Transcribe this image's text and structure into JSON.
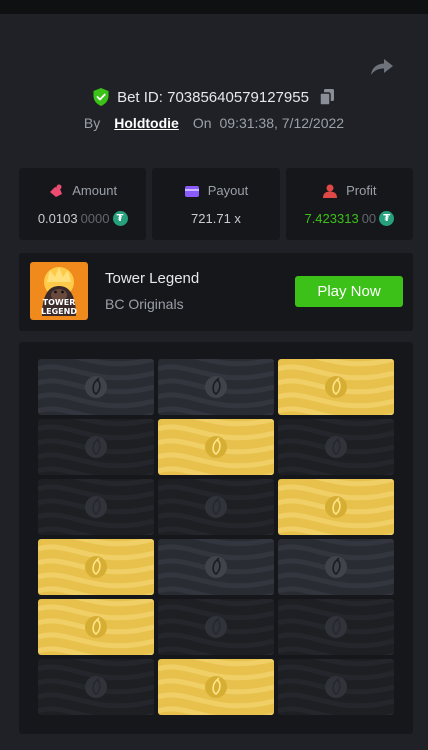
{
  "bet": {
    "id_label": "Bet ID: 70385640579127955",
    "by_label": "By",
    "user": "Holdtodie",
    "on_label": "On",
    "time": "09:31:38, 7/12/2022"
  },
  "stats": [
    {
      "label": "Amount",
      "value_main": "0.0103",
      "value_dim": "0000",
      "icon": "amount-icon",
      "color": "#ec4c72"
    },
    {
      "label": "Payout",
      "value_main": "721.71 x",
      "value_dim": "",
      "icon": "payout-icon",
      "color": "#8a5bff"
    },
    {
      "label": "Profit",
      "value_main": "7.423313",
      "value_dim": "00",
      "icon": "profit-icon",
      "color": "#e04848"
    }
  ],
  "currency": {
    "icon": "tether-icon",
    "glyph": "₮",
    "color": "#26a17b"
  },
  "game": {
    "title": "Tower Legend",
    "provider": "BC Originals",
    "play_label": "Play Now",
    "thumb_text_1": "TOWER",
    "thumb_text_2": "LEGEND"
  },
  "colors": {
    "accent_green": "#3bc117",
    "tile_gold": "#e7c14c",
    "tile_gray": "#2a2c33",
    "tile_dark": "#1d1f23"
  },
  "tower": {
    "rows": [
      [
        "hidden",
        "hidden",
        "picked"
      ],
      [
        "dark",
        "picked",
        "dark"
      ],
      [
        "dark",
        "dark",
        "picked"
      ],
      [
        "picked",
        "hidden",
        "hidden"
      ],
      [
        "picked",
        "dark",
        "dark"
      ],
      [
        "dark",
        "picked",
        "dark"
      ]
    ]
  }
}
